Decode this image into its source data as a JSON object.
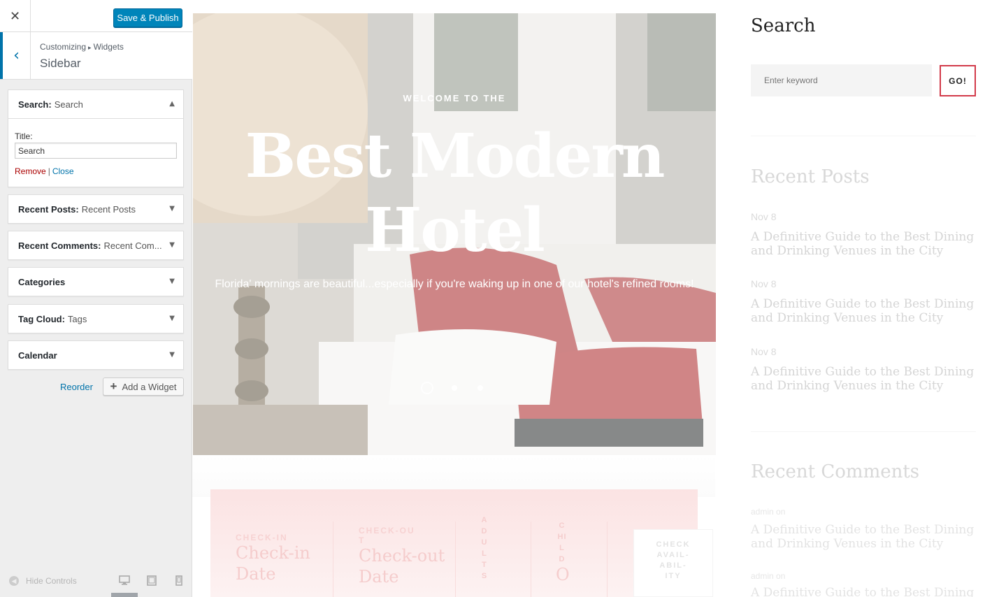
{
  "customizer": {
    "close_icon": "close-icon",
    "save_label": "Save & Publish",
    "breadcrumb_root": "Customizing",
    "breadcrumb_sep": "▸",
    "breadcrumb_leaf": "Widgets",
    "section_title": "Sidebar",
    "widgets": [
      {
        "type": "Search:",
        "name": "Search",
        "expanded": true
      },
      {
        "type": "Recent Posts:",
        "name": "Recent Posts"
      },
      {
        "type": "Recent Comments:",
        "name": "Recent Com..."
      },
      {
        "type": "Categories",
        "name": ""
      },
      {
        "type": "Tag Cloud:",
        "name": "Tags"
      },
      {
        "type": "Calendar",
        "name": ""
      }
    ],
    "search_form": {
      "title_label": "Title:",
      "title_value": "Search",
      "remove_label": "Remove",
      "separator": "|",
      "close_label": "Close"
    },
    "reorder_label": "Reorder",
    "add_widget_label": "Add a Widget",
    "hide_controls_label": "Hide Controls",
    "colors": {
      "primary": "#0085ba",
      "accent": "#0073aa",
      "danger": "#a00000"
    }
  },
  "preview": {
    "hero": {
      "kicker": "WELCOME TO THE",
      "title_line1": "Best Modern",
      "title_line2": "Hotel",
      "subtitle": "Florida' mornings are beautiful...especially if you're waking up in one of our hotel's refined rooms!",
      "slides": 3,
      "active_slide": 1
    },
    "booking": {
      "checkin_label": "CHECK-IN",
      "checkin_value_1": "Check-in",
      "checkin_value_2": "Date",
      "checkout_label_1": "CHECK-OU",
      "checkout_label_2": "T",
      "checkout_value_1": "Check-out",
      "checkout_value_2": "Date",
      "adults_letters": [
        "A",
        "D",
        "U",
        "L",
        "T",
        "S"
      ],
      "child_letters": [
        "C",
        "HI",
        "L",
        "D"
      ],
      "child_value": "O",
      "check_lines": [
        "CHECK",
        "AVAIL-",
        "ABIL-",
        "ITY"
      ]
    },
    "sidebar": {
      "search_heading": "Search",
      "search_placeholder": "Enter keyword",
      "go_label": "GO!",
      "recent_posts_heading": "Recent Posts",
      "posts": [
        {
          "date": "Nov 8",
          "title": "A Definitive Guide to the Best Dining and Drinking Venues in the City"
        },
        {
          "date": "Nov 8",
          "title": "A Definitive Guide to the Best Dining and Drinking Venues in the City"
        },
        {
          "date": "Nov 8",
          "title": "A Definitive Guide to the Best Dining and Drinking Venues in the City"
        }
      ],
      "recent_comments_heading": "Recent Comments",
      "comments": [
        {
          "meta": "admin on",
          "title": "A Definitive Guide to the Best Dining and Drinking Venues in the City"
        },
        {
          "meta": "admin on",
          "title": "A Definitive Guide to the Best Dining and Drinking Venues in the City"
        }
      ],
      "go_border_color": "#d23a4a"
    }
  }
}
